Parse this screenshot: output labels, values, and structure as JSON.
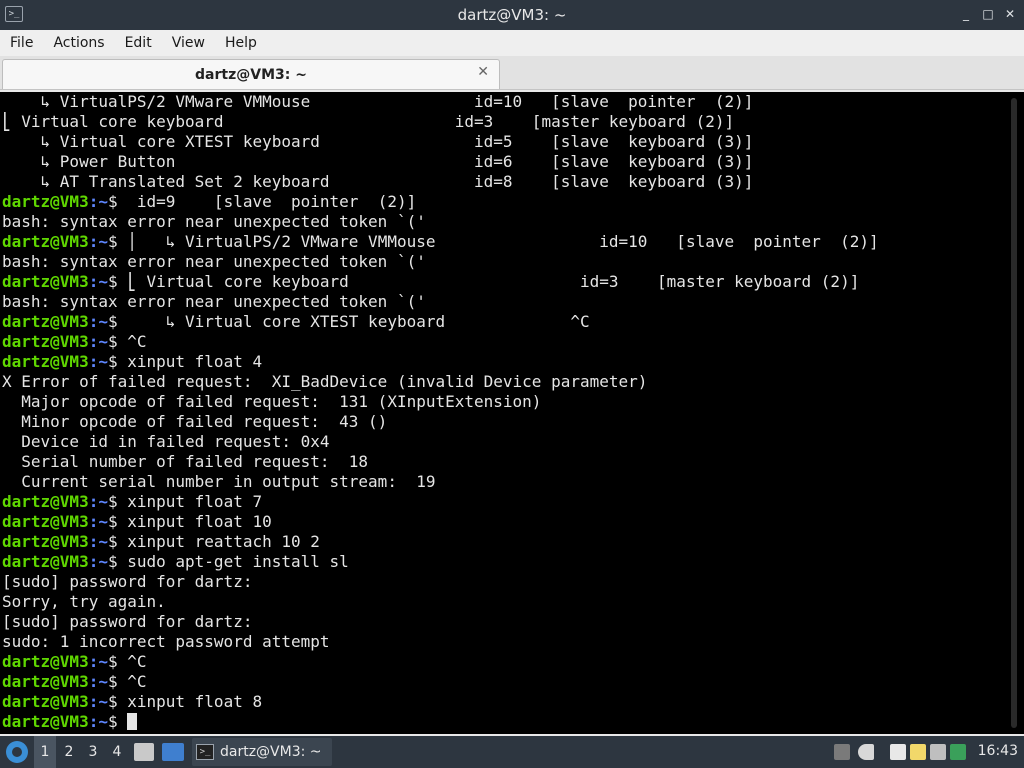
{
  "window": {
    "title": "dartz@VM3: ~",
    "app_icon_glyph": ">_",
    "controls": {
      "minimize": "_",
      "maximize": "□",
      "close": "✕"
    }
  },
  "menubar": {
    "items": [
      "File",
      "Actions",
      "Edit",
      "View",
      "Help"
    ]
  },
  "tab": {
    "label": "dartz@VM3: ~",
    "close_glyph": "✕"
  },
  "colors": {
    "prompt_user": "#5fd700",
    "prompt_path": "#5f87ff",
    "terminal_bg": "#000000",
    "terminal_fg": "#e5e5e5"
  },
  "terminal": {
    "prompt_user": "dartz@VM3",
    "prompt_path": ":~",
    "lines": [
      {
        "text": "    ↳ VirtualPS/2 VMware VMMouse                 id=10   [slave  pointer  (2)]"
      },
      {
        "text": "⎣ Virtual core keyboard                        id=3    [master keyboard (2)]"
      },
      {
        "text": "    ↳ Virtual core XTEST keyboard                id=5    [slave  keyboard (3)]"
      },
      {
        "text": "    ↳ Power Button                               id=6    [slave  keyboard (3)]"
      },
      {
        "text": "    ↳ AT Translated Set 2 keyboard               id=8    [slave  keyboard (3)]"
      },
      {
        "prompt": true,
        "text": "$  id=9    [slave  pointer  (2)]"
      },
      {
        "text": "bash: syntax error near unexpected token `('"
      },
      {
        "prompt": true,
        "text": "$ │   ↳ VirtualPS/2 VMware VMMouse                 id=10   [slave  pointer  (2)]"
      },
      {
        "text": "bash: syntax error near unexpected token `('"
      },
      {
        "prompt": true,
        "text": "$ ⎣ Virtual core keyboard                        id=3    [master keyboard (2)]"
      },
      {
        "text": "bash: syntax error near unexpected token `('"
      },
      {
        "prompt": true,
        "text": "$     ↳ Virtual core XTEST keyboard             ^C"
      },
      {
        "prompt": true,
        "text": "$ ^C"
      },
      {
        "prompt": true,
        "text": "$ xinput float 4"
      },
      {
        "text": "X Error of failed request:  XI_BadDevice (invalid Device parameter)"
      },
      {
        "text": "  Major opcode of failed request:  131 (XInputExtension)"
      },
      {
        "text": "  Minor opcode of failed request:  43 ()"
      },
      {
        "text": "  Device id in failed request: 0x4"
      },
      {
        "text": "  Serial number of failed request:  18"
      },
      {
        "text": "  Current serial number in output stream:  19"
      },
      {
        "prompt": true,
        "text": "$ xinput float 7"
      },
      {
        "prompt": true,
        "text": "$ xinput float 10"
      },
      {
        "prompt": true,
        "text": "$ xinput reattach 10 2"
      },
      {
        "prompt": true,
        "text": "$ sudo apt-get install sl"
      },
      {
        "text": "[sudo] password for dartz:"
      },
      {
        "text": "Sorry, try again."
      },
      {
        "text": "[sudo] password for dartz:"
      },
      {
        "text": "sudo: 1 incorrect password attempt"
      },
      {
        "prompt": true,
        "text": "$ ^C"
      },
      {
        "prompt": true,
        "text": "$ ^C"
      },
      {
        "prompt": true,
        "text": "$ xinput float 8"
      },
      {
        "prompt": true,
        "text": "$ ",
        "cursor": true
      }
    ]
  },
  "taskbar": {
    "workspaces": [
      "1",
      "2",
      "3",
      "4"
    ],
    "active_workspace": "1",
    "task_label": "dartz@VM3: ~",
    "clock": "16:43",
    "tray_icons": [
      "media-player-icon",
      "volume-icon",
      "clipboard-icon",
      "notes-icon",
      "network-icon",
      "update-icon"
    ]
  }
}
